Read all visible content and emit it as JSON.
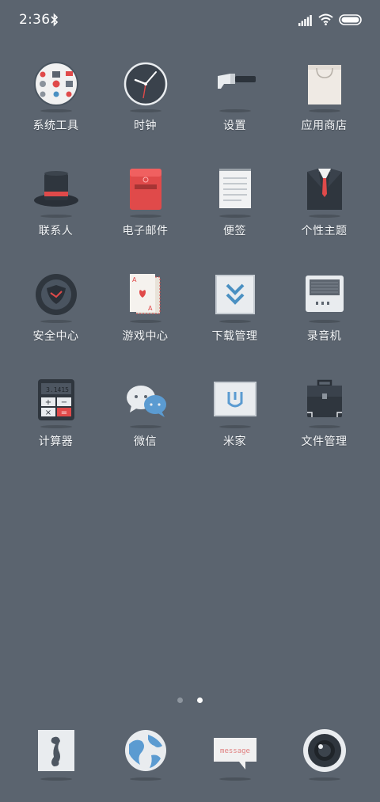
{
  "status": {
    "time": "2:36"
  },
  "apps": [
    {
      "label": "系统工具",
      "icon": "tools-folder-icon"
    },
    {
      "label": "时钟",
      "icon": "clock-icon"
    },
    {
      "label": "设置",
      "icon": "hammer-icon"
    },
    {
      "label": "应用商店",
      "icon": "shopping-bag-icon"
    },
    {
      "label": "联系人",
      "icon": "top-hat-icon"
    },
    {
      "label": "电子邮件",
      "icon": "mailbox-icon"
    },
    {
      "label": "便签",
      "icon": "notepad-icon"
    },
    {
      "label": "个性主题",
      "icon": "suit-icon"
    },
    {
      "label": "安全中心",
      "icon": "shield-icon"
    },
    {
      "label": "游戏中心",
      "icon": "playing-cards-icon"
    },
    {
      "label": "下载管理",
      "icon": "download-arrow-icon"
    },
    {
      "label": "录音机",
      "icon": "radio-recorder-icon"
    },
    {
      "label": "计算器",
      "icon": "calculator-icon"
    },
    {
      "label": "微信",
      "icon": "chat-bubbles-icon"
    },
    {
      "label": "米家",
      "icon": "mijia-icon"
    },
    {
      "label": "文件管理",
      "icon": "briefcase-icon"
    }
  ],
  "calculator_display": "3.1415",
  "message_text": "message",
  "dock": [
    {
      "icon": "phone-icon"
    },
    {
      "icon": "globe-icon"
    },
    {
      "icon": "message-icon"
    },
    {
      "icon": "camera-lens-icon"
    }
  ],
  "pager": {
    "pages": 2,
    "current": 2
  },
  "colors": {
    "background": "#5b646f",
    "accent_red": "#e04a4a"
  }
}
